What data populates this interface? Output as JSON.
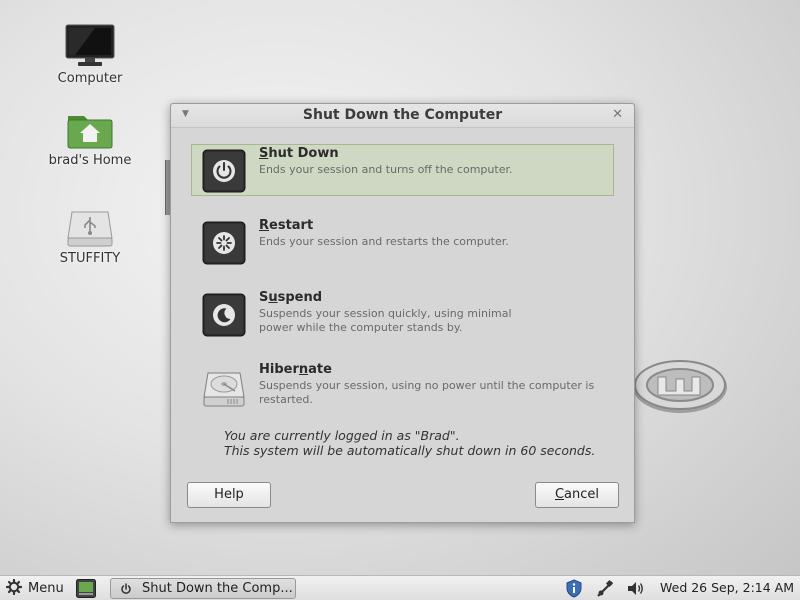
{
  "desktop": {
    "icons": [
      {
        "label": "Computer"
      },
      {
        "label": "brad's Home"
      },
      {
        "label": "STUFFITY"
      }
    ]
  },
  "dialog": {
    "title": "Shut Down the Computer",
    "options": [
      {
        "title_pre": "",
        "title_mnemonic": "S",
        "title_post": "hut Down",
        "desc": "Ends your session and turns off the computer.",
        "selected": true
      },
      {
        "title_pre": "",
        "title_mnemonic": "R",
        "title_post": "estart",
        "desc": "Ends your session and restarts the computer.",
        "selected": false
      },
      {
        "title_pre": "S",
        "title_mnemonic": "u",
        "title_post": "spend",
        "desc_line1": "Suspends your session quickly, using minimal",
        "desc_line2": "power while the computer stands by.",
        "selected": false
      },
      {
        "title_pre": "Hiber",
        "title_mnemonic": "n",
        "title_post": "ate",
        "desc": "Suspends your session, using no power until the computer is restarted.",
        "selected": false
      }
    ],
    "info_line1": "You are currently logged in as \"Brad\".",
    "info_line2": "This system will be automatically shut down in 60 seconds.",
    "help_label": "Help",
    "cancel_label_pre": "",
    "cancel_mnemonic": "C",
    "cancel_label_post": "ancel"
  },
  "taskbar": {
    "menu_label": "Menu",
    "task_label": "Shut Down the Comp...",
    "clock": "Wed 26 Sep,  2:14 AM"
  },
  "colors": {
    "selected_bg": "#cfd8c2",
    "selected_border": "#a6b892",
    "home_green": "#6aa84f"
  }
}
